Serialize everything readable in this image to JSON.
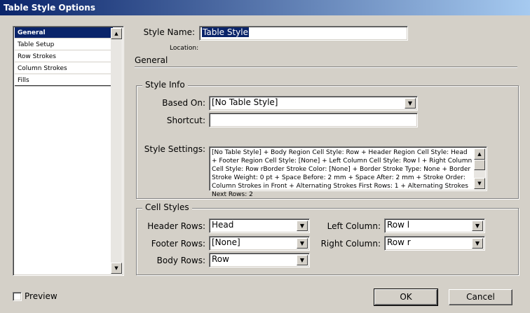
{
  "window": {
    "title": "Table Style Options"
  },
  "sidebar": {
    "items": [
      {
        "label": "General",
        "selected": true
      },
      {
        "label": "Table Setup",
        "selected": false
      },
      {
        "label": "Row Strokes",
        "selected": false
      },
      {
        "label": "Column Strokes",
        "selected": false
      },
      {
        "label": "Fills",
        "selected": false
      }
    ]
  },
  "style_name": {
    "label": "Style Name:",
    "value": "Table Style"
  },
  "location": {
    "label": "Location:"
  },
  "section_title": "General",
  "style_info": {
    "title": "Style Info",
    "based_on": {
      "label": "Based On:",
      "value": "[No Table Style]"
    },
    "shortcut": {
      "label": "Shortcut:",
      "value": ""
    },
    "settings": {
      "label": "Style Settings:",
      "text": "[No Table Style] + Body Region Cell Style: Row + Header Region Cell Style: Head + Footer Region Cell Style: [None] + Left Column Cell Style: Row l + Right Column Cell Style: Row rBorder Stroke Color: [None] + Border Stroke Type: None + Border Stroke Weight: 0 pt + Space Before: 2 mm + Space After: 2 mm + Stroke Order: Column Strokes in Front + Alternating Strokes First Rows: 1 + Alternating Strokes Next Rows: 2"
    }
  },
  "cell_styles": {
    "title": "Cell Styles",
    "header_rows": {
      "label": "Header Rows:",
      "value": "Head"
    },
    "footer_rows": {
      "label": "Footer Rows:",
      "value": "[None]"
    },
    "body_rows": {
      "label": "Body Rows:",
      "value": "Row"
    },
    "left_column": {
      "label": "Left Column:",
      "value": "Row l"
    },
    "right_column": {
      "label": "Right Column:",
      "value": "Row r"
    }
  },
  "preview": {
    "label": "Preview",
    "checked": false
  },
  "buttons": {
    "ok": "OK",
    "cancel": "Cancel"
  },
  "icons": {
    "dropdown": "chevron-down-icon",
    "scroll_up": "arrow-up-icon",
    "scroll_down": "arrow-down-icon"
  }
}
